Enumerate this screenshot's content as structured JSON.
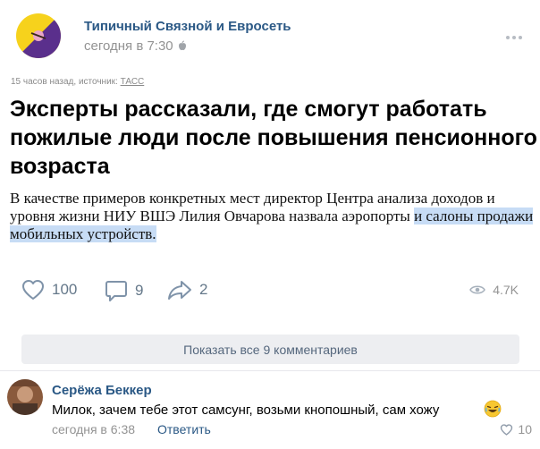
{
  "post": {
    "group_name": "Типичный Связной и Евросеть",
    "time": "сегодня в 7:30",
    "meta_prefix": "15 часов назад, источник: ",
    "source": "ТАСС",
    "headline": "Эксперты рассказали, где смогут работать пожилые люди после повышения пенсионного возраста",
    "lead_plain": "В качестве примеров конкретных мест директор Центра анализа доходов и уровня жизни НИУ ВШЭ Лилия Овчарова назвала аэропорты ",
    "lead_highlight": "и салоны продажи мобильных устройств.",
    "likes": "100",
    "comments": "9",
    "shares": "2",
    "views": "4.7K"
  },
  "show_comments_label": "Показать все 9 комментариев",
  "comment": {
    "author": "Серёжа Беккер",
    "text": "Милок, зачем тебе этот самсунг, возьми кнопошный, сам хожу",
    "time": "сегодня в 6:38",
    "reply_label": "Ответить",
    "likes": "10"
  },
  "colors": {
    "link": "#2a5885",
    "highlight": "#c7dcf5",
    "avatar_yellow": "#f6d21c",
    "avatar_purple": "#5a2f8c"
  }
}
